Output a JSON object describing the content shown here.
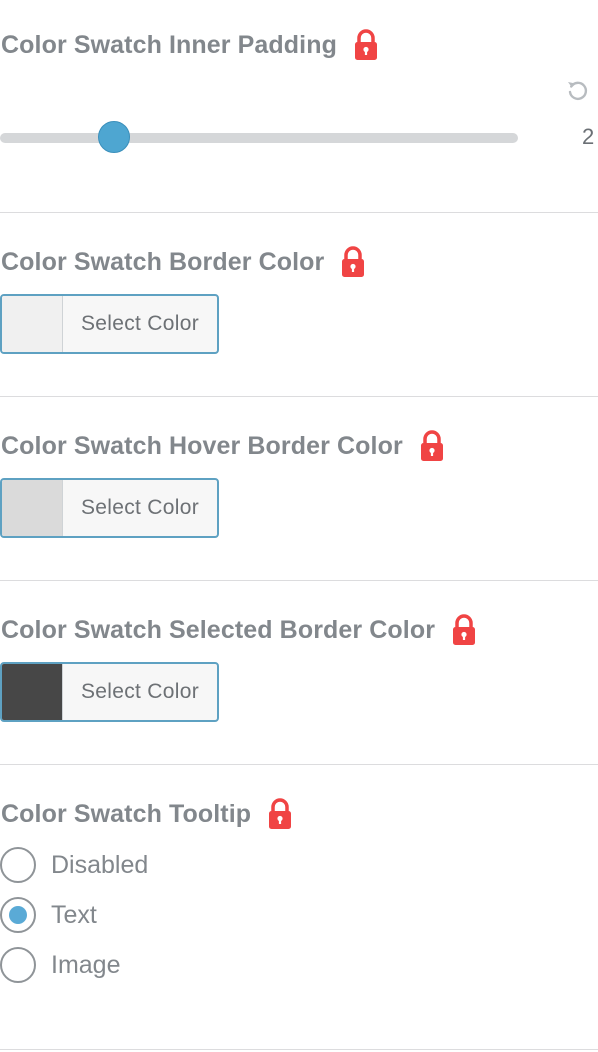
{
  "sections": {
    "inner_padding": {
      "label": "Color Swatch Inner Padding",
      "value": "2",
      "slider_fraction": 0.22
    },
    "border_color": {
      "label": "Color Swatch Border Color",
      "button_label": "Select Color",
      "swatch_color": "#f0f0f0"
    },
    "hover_border_color": {
      "label": "Color Swatch Hover Border Color",
      "button_label": "Select Color",
      "swatch_color": "#dadada"
    },
    "selected_border_color": {
      "label": "Color Swatch Selected Border Color",
      "button_label": "Select Color",
      "swatch_color": "#474747"
    },
    "tooltip": {
      "label": "Color Swatch Tooltip",
      "options": [
        {
          "label": "Disabled",
          "checked": false
        },
        {
          "label": "Text",
          "checked": true
        },
        {
          "label": "Image",
          "checked": false
        }
      ]
    }
  },
  "colors": {
    "accent": "#4ea6d1",
    "lock": "#f04444",
    "button_border": "#5ea1c2"
  },
  "icons": {
    "lock": "lock-icon",
    "reset": "reset-icon"
  }
}
